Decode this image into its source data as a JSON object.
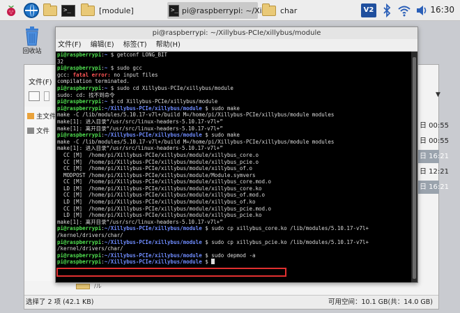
{
  "taskbar": {
    "tasks": [
      {
        "label": "[module]"
      },
      {
        "label": "pi@raspberrypi: ~/Xill..."
      },
      {
        "label": "char"
      }
    ],
    "tray": {
      "vnc_label": "V2"
    },
    "clock": "16:30"
  },
  "desktop": {
    "trash_label": "回收站"
  },
  "file_manager": {
    "menu_label": "文件(F)",
    "sidebar": [
      {
        "label": "主文件"
      },
      {
        "label": "文件"
      }
    ],
    "rows": [
      {
        "text": "日 00:55",
        "selected": false
      },
      {
        "text": "日 00:55",
        "selected": false
      },
      {
        "text": "日 16:21",
        "selected": true
      },
      {
        "text": "日 12:21",
        "selected": false
      },
      {
        "text": "日 16:21",
        "selected": true
      }
    ],
    "status_left": "选择了 2 项 (42.1 KB)",
    "status_right": "可用空间：10.1 GB(共：14.0 GB)",
    "bottom_partial": "/ル"
  },
  "terminal": {
    "title": "pi@raspberrypi: ~/Xillybus-PCIe/xillybus/module",
    "menu": [
      {
        "label": "文件(F)"
      },
      {
        "label": "编辑(E)"
      },
      {
        "label": "标签(T)"
      },
      {
        "label": "帮助(H)"
      }
    ],
    "lines": [
      {
        "type": "prompt",
        "user": "pi@raspberrypi",
        "sep": ":",
        "path": "~",
        "cmd": " $ getconf LONG_BIT"
      },
      {
        "type": "out",
        "text": "32"
      },
      {
        "type": "prompt",
        "user": "pi@raspberrypi",
        "sep": ":",
        "path": "~",
        "cmd": " $ sudo gcc"
      },
      {
        "type": "gcc",
        "prefix": "gcc: ",
        "err": "fatal error:",
        "text": " no input files"
      },
      {
        "type": "out",
        "text": "compilation terminated."
      },
      {
        "type": "prompt",
        "user": "pi@raspberrypi",
        "sep": ":",
        "path": "~",
        "cmd": " $ sudo cd Xillybus-PCIe/xillybus/module"
      },
      {
        "type": "out",
        "text": "sudo: cd: 找不到命令"
      },
      {
        "type": "prompt",
        "user": "pi@raspberrypi",
        "sep": ":",
        "path": "~",
        "cmd": " $ cd Xillybus-PCIe/xillybus/module"
      },
      {
        "type": "prompt",
        "user": "pi@raspberrypi",
        "sep": ":",
        "path": "~/Xillybus-PCIe/xillybus/module",
        "cmd": " $ sudo make"
      },
      {
        "type": "out",
        "text": "make -C /lib/modules/5.10.17-v7l+/build M=/home/pi/Xillybus-PCIe/xillybus/module modules"
      },
      {
        "type": "out",
        "text": "make[1]: 进入目录“/usr/src/linux-headers-5.10.17-v7l+”"
      },
      {
        "type": "out",
        "text": "make[1]: 离开目录“/usr/src/linux-headers-5.10.17-v7l+”"
      },
      {
        "type": "prompt",
        "user": "pi@raspberrypi",
        "sep": ":",
        "path": "~/Xillybus-PCIe/xillybus/module",
        "cmd": " $ sudo make"
      },
      {
        "type": "out",
        "text": "make -C /lib/modules/5.10.17-v7l+/build M=/home/pi/Xillybus-PCIe/xillybus/module modules"
      },
      {
        "type": "out",
        "text": "make[1]: 进入目录“/usr/src/linux-headers-5.10.17-v7l+”"
      },
      {
        "type": "out",
        "text": "  CC [M]  /home/pi/Xillybus-PCIe/xillybus/module/xillybus_core.o"
      },
      {
        "type": "out",
        "text": "  CC [M]  /home/pi/Xillybus-PCIe/xillybus/module/xillybus_pcie.o"
      },
      {
        "type": "out",
        "text": "  CC [M]  /home/pi/Xillybus-PCIe/xillybus/module/xillybus_of.o"
      },
      {
        "type": "out",
        "text": "  MODPOST /home/pi/Xillybus-PCIe/xillybus/module/Module.symvers"
      },
      {
        "type": "out",
        "text": "  CC [M]  /home/pi/Xillybus-PCIe/xillybus/module/xillybus_core.mod.o"
      },
      {
        "type": "out",
        "text": "  LD [M]  /home/pi/Xillybus-PCIe/xillybus/module/xillybus_core.ko"
      },
      {
        "type": "out",
        "text": "  CC [M]  /home/pi/Xillybus-PCIe/xillybus/module/xillybus_of.mod.o"
      },
      {
        "type": "out",
        "text": "  LD [M]  /home/pi/Xillybus-PCIe/xillybus/module/xillybus_of.ko"
      },
      {
        "type": "out",
        "text": "  CC [M]  /home/pi/Xillybus-PCIe/xillybus/module/xillybus_pcie.mod.o"
      },
      {
        "type": "out",
        "text": "  LD [M]  /home/pi/Xillybus-PCIe/xillybus/module/xillybus_pcie.ko"
      },
      {
        "type": "out",
        "text": "make[1]: 离开目录“/usr/src/linux-headers-5.10.17-v7l+”"
      },
      {
        "type": "prompt",
        "user": "pi@raspberrypi",
        "sep": ":",
        "path": "~/Xillybus-PCIe/xillybus/module",
        "cmd": " $ sudo cp xillybus_core.ko /lib/modules/5.10.17-v7l+"
      },
      {
        "type": "out",
        "text": "/kernel/drivers/char/"
      },
      {
        "type": "prompt",
        "user": "pi@raspberrypi",
        "sep": ":",
        "path": "~/Xillybus-PCIe/xillybus/module",
        "cmd": " $ sudo cp xillybus_pcie.ko /lib/modules/5.10.17-v7l+"
      },
      {
        "type": "out",
        "text": "/kernel/drivers/char/"
      },
      {
        "type": "prompt",
        "user": "pi@raspberrypi",
        "sep": ":",
        "path": "~/Xillybus-PCIe/xillybus/module",
        "cmd": " $ sudo depmod -a"
      },
      {
        "type": "prompt_cursor",
        "user": "pi@raspberrypi",
        "sep": ":",
        "path": "~/Xillybus-PCIe/xillybus/module",
        "cmd": " $ "
      }
    ]
  },
  "colors": {
    "prompt_user": "#50e050",
    "prompt_path": "#6f8cff",
    "error": "#ff5555",
    "highlight_box": "#e23030"
  }
}
